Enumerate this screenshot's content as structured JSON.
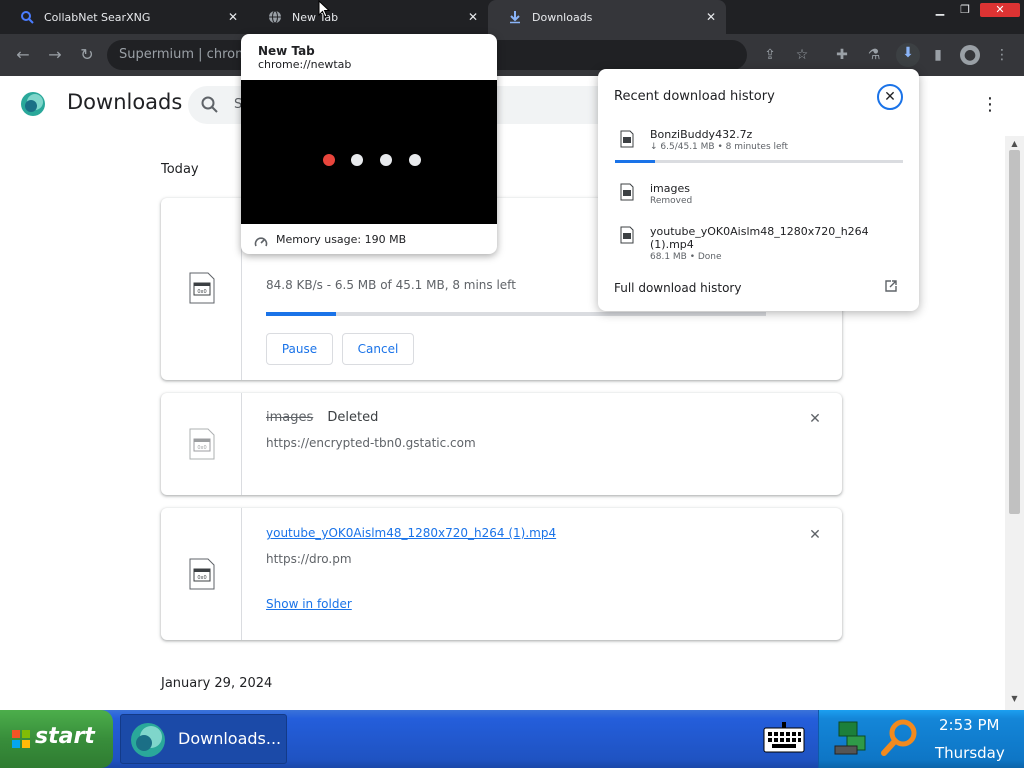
{
  "browser": {
    "tabs": [
      {
        "title": "CollabNet SearXNG",
        "icon": "search-icon"
      },
      {
        "title": "New Tab",
        "icon": "globe-icon"
      },
      {
        "title": "Downloads",
        "icon": "download-icon"
      }
    ],
    "omnibox_text": "Supermium  |  chrom"
  },
  "page": {
    "title": "Downloads",
    "search_placeholder": "S",
    "today_label": "Today",
    "older_label": "January 29, 2024"
  },
  "downloads": [
    {
      "status": "84.8 KB/s - 6.5 MB of 45.1 MB, 8 mins left",
      "progress": 0.14,
      "pause_label": "Pause",
      "cancel_label": "Cancel"
    },
    {
      "name": "images",
      "state": "Deleted",
      "url": "https://encrypted-tbn0.gstatic.com"
    },
    {
      "name": "youtube_yOK0Aislm48_1280x720_h264 (1).mp4",
      "url": "https://dro.pm",
      "action": "Show in folder"
    }
  ],
  "hovercard": {
    "title": "New Tab",
    "url": "chrome://newtab",
    "memory": "Memory usage: 190 MB"
  },
  "bubble": {
    "title": "Recent download history",
    "items": [
      {
        "name": "BonziBuddy432.7z",
        "sub": "↓ 6.5/45.1 MB • 8 minutes left",
        "progress": 0.14
      },
      {
        "name": "images",
        "sub": "Removed"
      },
      {
        "name": "youtube_yOK0Aislm48_1280x720_h264",
        "name2": "(1).mp4",
        "sub": "68.1 MB • Done"
      }
    ],
    "footer": "Full download history"
  },
  "taskbar": {
    "start_label": "start",
    "active_window": "Downloads...",
    "clock_time": "2:53 PM",
    "clock_day": "Thursday"
  },
  "colors": {
    "accent": "#1a73e8",
    "chrome_dark": "#202124",
    "xp_blue": "#245edb",
    "xp_green": "#388e3b"
  }
}
